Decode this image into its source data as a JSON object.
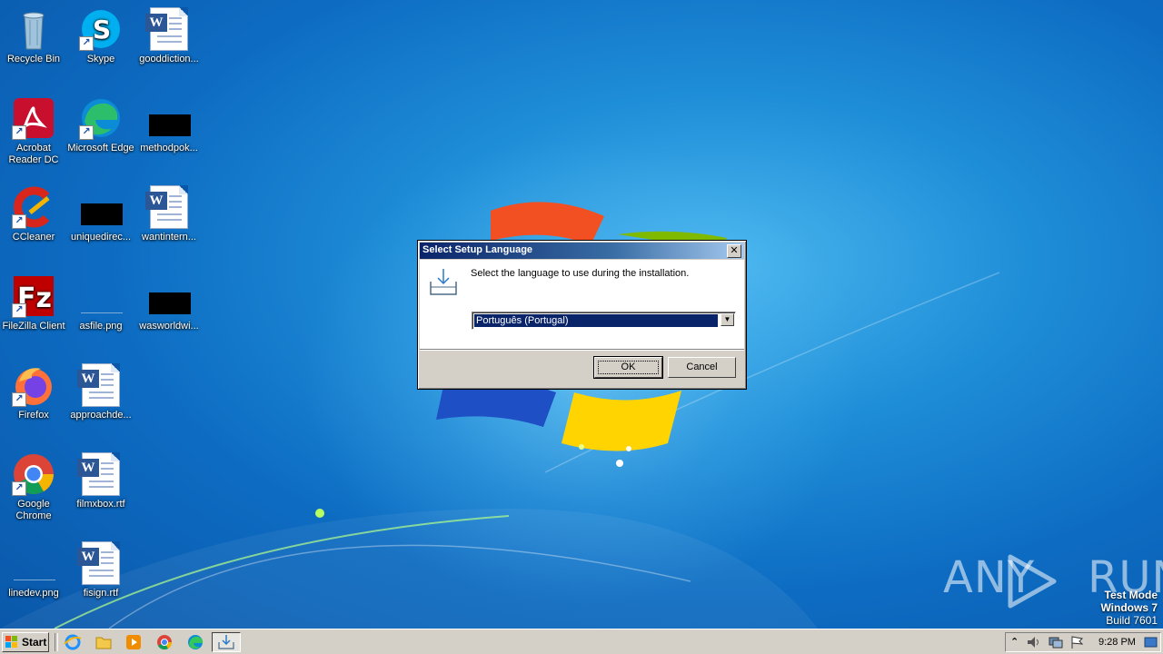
{
  "desktop": {
    "icons": [
      {
        "label": "Recycle Bin",
        "icon": "recycle-bin-icon"
      },
      {
        "label": "Skype",
        "icon": "skype-icon"
      },
      {
        "label": "gooddiction...",
        "icon": "word-document-icon"
      },
      {
        "label": "Acrobat Reader DC",
        "icon": "acrobat-reader-icon"
      },
      {
        "label": "Microsoft Edge",
        "icon": "edge-icon"
      },
      {
        "label": "methodpok...",
        "icon": "black-file-icon"
      },
      {
        "label": "CCleaner",
        "icon": "ccleaner-icon"
      },
      {
        "label": "uniquedirec...",
        "icon": "black-file-icon"
      },
      {
        "label": "wantintern...",
        "icon": "word-document-icon"
      },
      {
        "label": "FileZilla Client",
        "icon": "filezilla-icon"
      },
      {
        "label": "asfile.png",
        "icon": "png-file-icon"
      },
      {
        "label": "wasworldwi...",
        "icon": "black-file-icon"
      },
      {
        "label": "Firefox",
        "icon": "firefox-icon"
      },
      {
        "label": "approachde...",
        "icon": "word-document-icon"
      },
      {
        "label": "Google Chrome",
        "icon": "chrome-icon"
      },
      {
        "label": "filmxbox.rtf",
        "icon": "word-document-icon"
      },
      {
        "label": "linedev.png",
        "icon": "png-file-icon"
      },
      {
        "label": "fisign.rtf",
        "icon": "word-document-icon"
      }
    ]
  },
  "dialog": {
    "title": "Select Setup Language",
    "close_label": "✕",
    "prompt": "Select the language to use during the installation.",
    "selected_language": "Português (Portugal)",
    "ok_label": "OK",
    "cancel_label": "Cancel"
  },
  "watermark": {
    "brand_left": "ANY",
    "brand_right": "RUN",
    "test_mode": "Test Mode",
    "os": "Windows 7",
    "build": "Build 7601"
  },
  "taskbar": {
    "start_label": "Start",
    "clock": "9:28 PM",
    "tray_expand": "⌃",
    "quick_launch": [
      "internet-explorer-icon",
      "explorer-folder-icon",
      "media-player-icon",
      "chrome-icon",
      "edge-icon"
    ]
  },
  "colors": {
    "desktop_blue": "#0d6cc2",
    "title_bar": "#0a246a",
    "selection": "#0a246a",
    "face": "#d4d0c8"
  }
}
